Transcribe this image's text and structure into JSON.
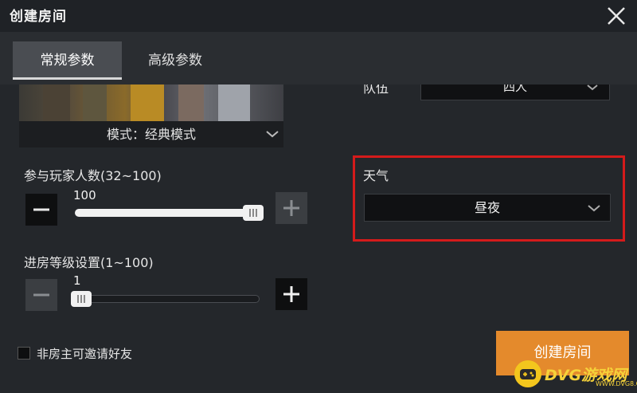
{
  "window": {
    "title": "创建房间"
  },
  "tabs": [
    {
      "label": "常规参数",
      "active": true
    },
    {
      "label": "高级参数",
      "active": false
    }
  ],
  "mode": {
    "label": "模式：经典模式"
  },
  "players": {
    "label": "参与玩家人数(32~100)",
    "value": "100",
    "fill": 1.0
  },
  "level": {
    "label": "进房等级设置(1~100)",
    "value": "1",
    "fill": 0.0
  },
  "team": {
    "label": "队伍",
    "value": "四人"
  },
  "weather": {
    "label": "天气",
    "value": "昼夜"
  },
  "invite": {
    "label": "非房主可邀请好友",
    "checked": false
  },
  "actions": {
    "create_label": "创建房间"
  },
  "watermark": {
    "text": "DVG游戏网",
    "url": "WWW.DVG8.CN"
  },
  "colors": {
    "accent": "#e48a2c",
    "highlight": "#d41b1b",
    "background": "#24272b"
  }
}
